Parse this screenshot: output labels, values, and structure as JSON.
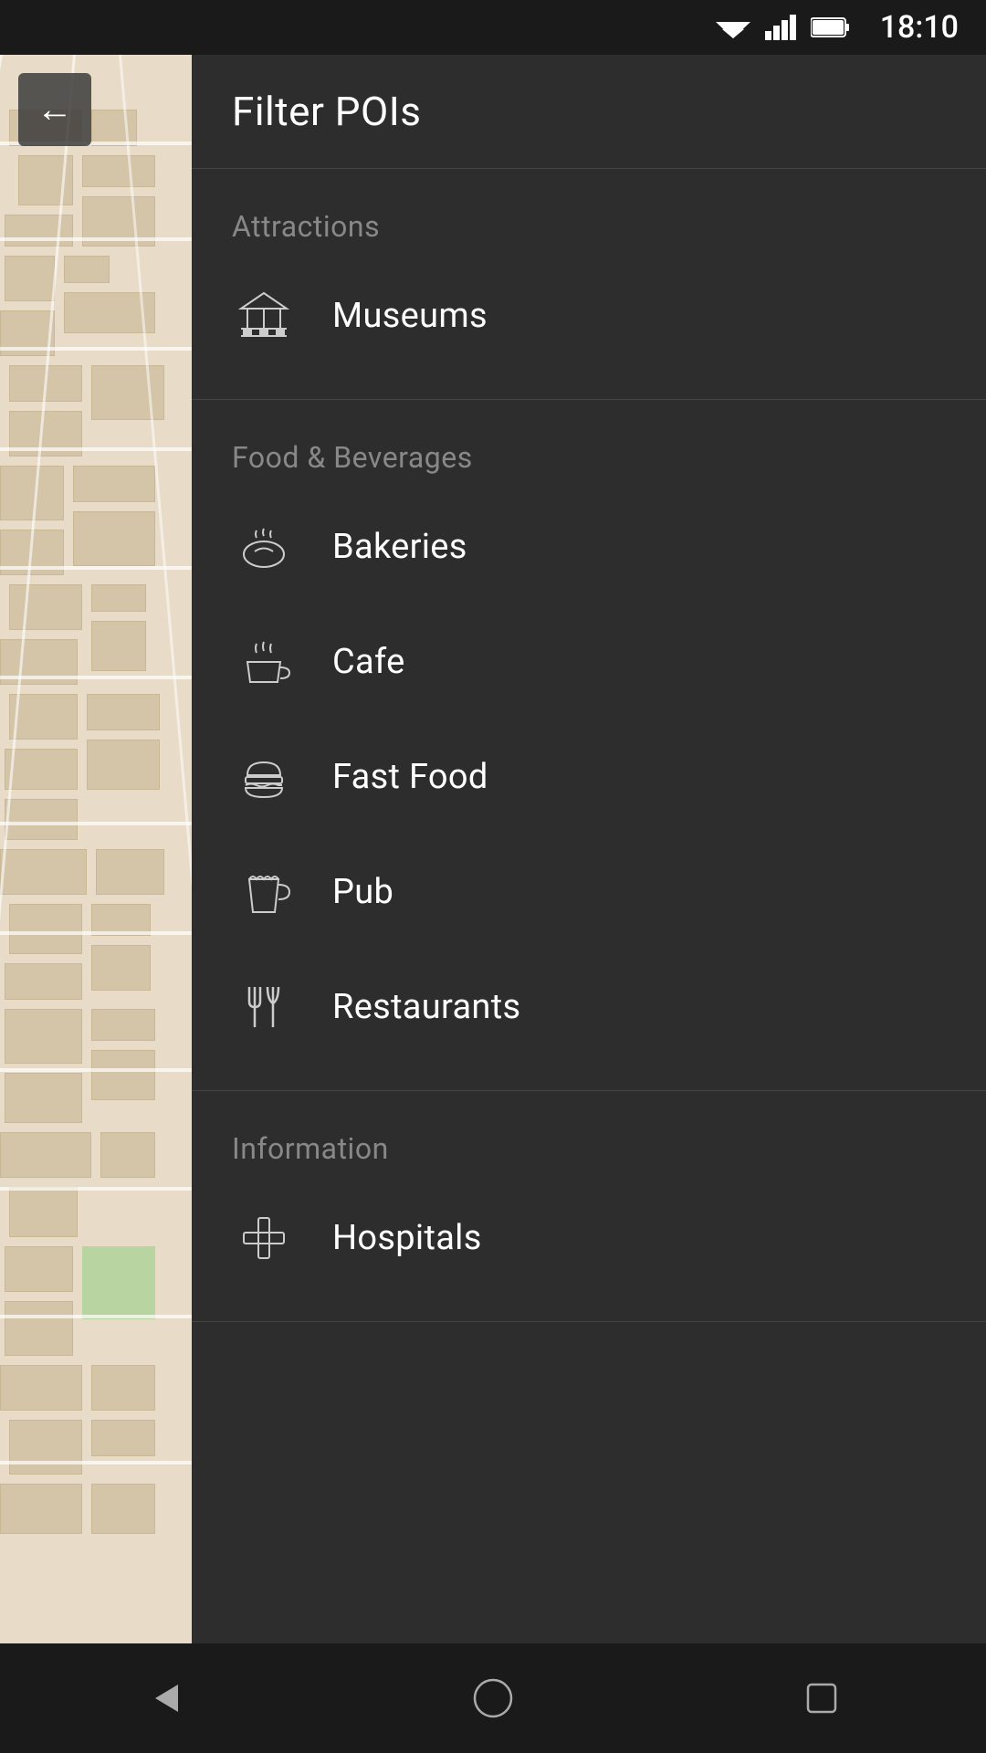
{
  "statusBar": {
    "time": "18:10",
    "wifi": "wifi-icon",
    "signal": "signal-icon",
    "battery": "battery-icon"
  },
  "backButton": {
    "label": "←"
  },
  "panel": {
    "title": "Filter POIs",
    "sections": [
      {
        "id": "attractions",
        "label": "Attractions",
        "items": [
          {
            "id": "museums",
            "label": "Museums",
            "icon": "museum"
          }
        ]
      },
      {
        "id": "food-beverages",
        "label": "Food & Beverages",
        "items": [
          {
            "id": "bakeries",
            "label": "Bakeries",
            "icon": "bakery"
          },
          {
            "id": "cafe",
            "label": "Cafe",
            "icon": "cafe"
          },
          {
            "id": "fast-food",
            "label": "Fast Food",
            "icon": "fastfood"
          },
          {
            "id": "pub",
            "label": "Pub",
            "icon": "pub"
          },
          {
            "id": "restaurants",
            "label": "Restaurants",
            "icon": "restaurant"
          }
        ]
      },
      {
        "id": "information",
        "label": "Information",
        "items": [
          {
            "id": "hospitals",
            "label": "Hospitals",
            "icon": "hospital"
          }
        ]
      }
    ]
  },
  "navBar": {
    "back": "back-icon",
    "home": "home-icon",
    "recent": "recent-icon"
  }
}
